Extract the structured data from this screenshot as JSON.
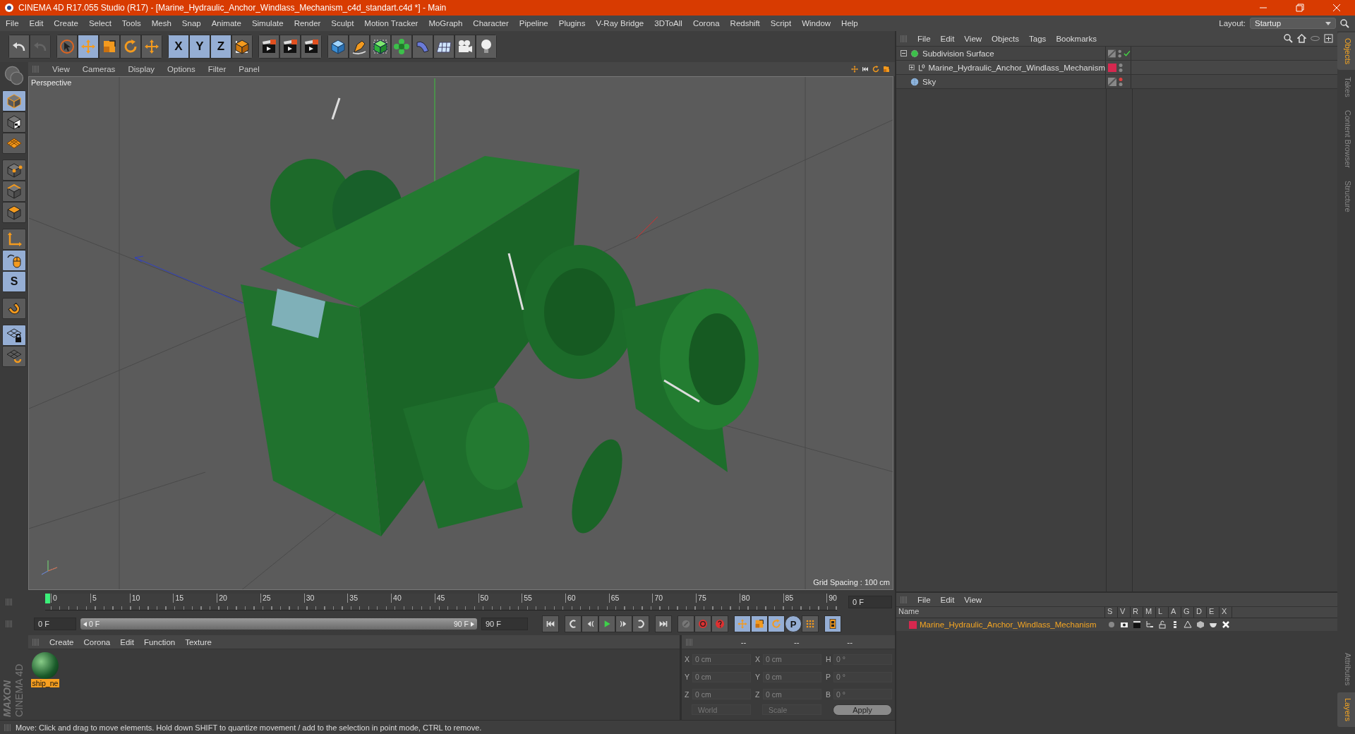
{
  "window": {
    "title": "CINEMA 4D R17.055 Studio (R17) - [Marine_Hydraulic_Anchor_Windlass_Mechanism_c4d_standart.c4d *] - Main"
  },
  "menu": [
    "File",
    "Edit",
    "Create",
    "Select",
    "Tools",
    "Mesh",
    "Snap",
    "Animate",
    "Simulate",
    "Render",
    "Sculpt",
    "Motion Tracker",
    "MoGraph",
    "Character",
    "Pipeline",
    "Plugins",
    "V-Ray Bridge",
    "3DToAll",
    "Corona",
    "Redshift",
    "Script",
    "Window",
    "Help"
  ],
  "layout": {
    "label": "Layout:",
    "value": "Startup"
  },
  "toolbar_groups": [
    {
      "buttons": [
        {
          "kind": "undo-arrow",
          "selected": false,
          "disabled": false
        },
        {
          "kind": "undo-arrow",
          "selected": false,
          "disabled": true
        }
      ]
    },
    {
      "buttons": [
        {
          "kind": "arrow-cursor",
          "selected": false,
          "disabled": false
        },
        {
          "kind": "move-arrows",
          "selected": true,
          "disabled": false
        },
        {
          "kind": "scale-square",
          "selected": false,
          "disabled": false
        },
        {
          "kind": "rotate-circle",
          "selected": false,
          "disabled": false
        },
        {
          "kind": "move-arrows",
          "selected": false,
          "disabled": false
        }
      ]
    },
    {
      "buttons": [
        {
          "kind": "letter",
          "label": "X",
          "selected": true,
          "disabled": false
        },
        {
          "kind": "letter",
          "label": "Y",
          "selected": true,
          "disabled": false
        },
        {
          "kind": "letter",
          "label": "Z",
          "selected": true,
          "disabled": false
        },
        {
          "kind": "coordinate-box",
          "selected": false,
          "disabled": false
        }
      ]
    },
    {
      "buttons": [
        {
          "kind": "clapper",
          "selected": false,
          "disabled": false
        },
        {
          "kind": "clapper",
          "selected": false,
          "disabled": false
        },
        {
          "kind": "clapper",
          "selected": false,
          "disabled": false
        }
      ]
    },
    {
      "buttons": [
        {
          "kind": "cube",
          "selected": false,
          "disabled": false
        },
        {
          "kind": "pen",
          "selected": false,
          "disabled": false
        },
        {
          "kind": "green-cube",
          "selected": false,
          "disabled": false
        },
        {
          "kind": "flower",
          "selected": false,
          "disabled": false
        },
        {
          "kind": "bent-shape",
          "selected": false,
          "disabled": false
        },
        {
          "kind": "grid-plane",
          "selected": false,
          "disabled": false
        },
        {
          "kind": "camera",
          "selected": false,
          "disabled": false
        },
        {
          "kind": "light-bulb",
          "selected": false,
          "disabled": false
        }
      ]
    }
  ],
  "left_tools": [
    {
      "kind": "model-cube",
      "selected": true
    },
    {
      "kind": "checker-cube",
      "selected": false
    },
    {
      "kind": "grid-diamond",
      "selected": false
    },
    {
      "kind": "cube-points",
      "selected": false
    },
    {
      "kind": "cube-edges",
      "selected": false
    },
    {
      "kind": "cube-polygon",
      "selected": false
    },
    {
      "kind": "axis-corner",
      "selected": false
    },
    {
      "kind": "mouse",
      "selected": true
    },
    {
      "kind": "letter",
      "label": "S",
      "selected": true
    },
    {
      "kind": "magnet",
      "selected": false
    },
    {
      "kind": "grid-lock",
      "selected": true
    },
    {
      "kind": "grid-cycle",
      "selected": false
    }
  ],
  "viewport": {
    "menu": [
      "View",
      "Cameras",
      "Display",
      "Options",
      "Filter",
      "Panel"
    ],
    "camera": "Perspective",
    "grid_spacing": "Grid Spacing : 100 cm"
  },
  "timeline": {
    "ruler": [
      "0",
      "5",
      "10",
      "15",
      "20",
      "25",
      "30",
      "35",
      "40",
      "45",
      "50",
      "55",
      "60",
      "65",
      "70",
      "75",
      "80",
      "85",
      "90"
    ],
    "level": 0,
    "current_frame": "0 F",
    "start_field": "0 F",
    "range": {
      "start": "0 F",
      "end": "90 F",
      "level": 1
    },
    "end_field": "90 F",
    "controls": [
      {
        "kind": "skip-start",
        "selected": false
      },
      {
        "kind": "prev-key",
        "selected": false
      },
      {
        "kind": "step-back",
        "selected": false
      },
      {
        "kind": "play",
        "selected": false
      },
      {
        "kind": "step-forward",
        "selected": false
      },
      {
        "kind": "next-key",
        "selected": false
      },
      {
        "kind": "skip-end",
        "selected": false
      },
      {
        "kind": "key",
        "selected": false
      },
      {
        "kind": "record",
        "selected": false
      },
      {
        "kind": "autokey",
        "selected": false
      },
      {
        "kind": "move-arrows",
        "selected": true
      },
      {
        "kind": "scale-square",
        "selected": true
      },
      {
        "kind": "rotate-circle",
        "selected": true
      },
      {
        "kind": "letter",
        "label": "P",
        "selected": true
      },
      {
        "kind": "dot-grid",
        "selected": false
      },
      {
        "kind": "film-strip",
        "selected": true
      }
    ]
  },
  "materials": {
    "menu": [
      "Create",
      "Corona",
      "Edit",
      "Function",
      "Texture"
    ],
    "items": [
      {
        "name": "ship_ne",
        "selected": true
      }
    ]
  },
  "logo": {
    "brand": "MAXON",
    "product": "CINEMA 4D"
  },
  "coordinates": {
    "headers": [
      "--",
      "--",
      "--"
    ],
    "rows": [
      {
        "axis": "X",
        "position": "0 cm",
        "size_axis": "X",
        "size": "0 cm",
        "rot_axis": "H",
        "rotation": "0 °"
      },
      {
        "axis": "Y",
        "position": "0 cm",
        "size_axis": "Y",
        "size": "0 cm",
        "rot_axis": "P",
        "rotation": "0 °"
      },
      {
        "axis": "Z",
        "position": "0 cm",
        "size_axis": "Z",
        "size": "0 cm",
        "rot_axis": "B",
        "rotation": "0 °"
      }
    ],
    "space": "World",
    "mode": "Scale",
    "apply": "Apply"
  },
  "status_bar": "Move: Click and drag to move elements. Hold down SHIFT to quantize movement / add to the selection in point mode, CTRL to remove.",
  "objects": {
    "menu": [
      "File",
      "Edit",
      "View",
      "Objects",
      "Tags",
      "Bookmarks"
    ],
    "tree": [
      {
        "name": "Subdivision Surface",
        "kind": "subdivision",
        "expanded": true,
        "editor_visible": true,
        "enabled": true,
        "children": [
          {
            "name": "Marine_Hydraulic_Anchor_Windlass_Mechanism",
            "kind": "null",
            "expanded": false,
            "editor_visible": true,
            "color": "#d6284f"
          }
        ]
      },
      {
        "name": "Sky",
        "kind": "sky",
        "editor_visible": false
      }
    ]
  },
  "layers": {
    "menu": [
      "File",
      "Edit",
      "View"
    ],
    "columns": [
      "Name",
      "S",
      "V",
      "R",
      "M",
      "L",
      "A",
      "G",
      "D",
      "E",
      "X"
    ],
    "rows": [
      {
        "name": "Marine_Hydraulic_Anchor_Windlass_Mechanism",
        "color": "#d6284f"
      }
    ]
  },
  "side_tabs": {
    "top": [
      {
        "label": "Objects",
        "selected": true
      },
      {
        "label": "Takes",
        "selected": false
      },
      {
        "label": "Content Browser",
        "selected": false
      },
      {
        "label": "Structure",
        "selected": false
      }
    ],
    "bottom": [
      {
        "label": "Attributes",
        "selected": false
      },
      {
        "label": "Layers",
        "selected": true
      }
    ]
  }
}
